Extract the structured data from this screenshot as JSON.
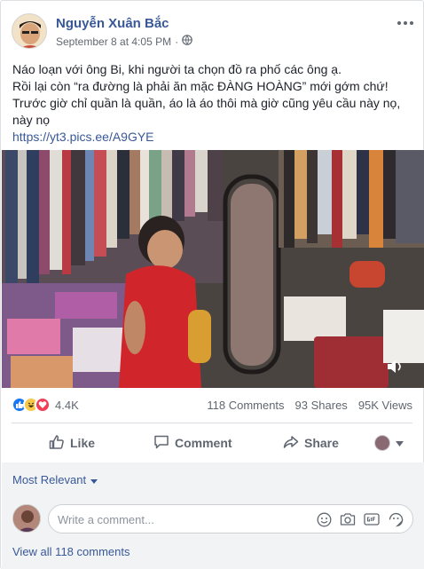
{
  "post": {
    "author": "Nguyễn Xuân Bắc",
    "timestamp": "September 8 at 4:05 PM",
    "separator": "·",
    "text_lines": [
      "Náo loạn với ông Bi, khi người ta chọn đồ ra phố các ông ạ.",
      "Rồi lại còn “ra đường là phải ăn mặc ĐÀNG HOÀNG” mới gớm chứ!",
      "Trước giờ chỉ quần là quần, áo là áo thôi mà giờ cũng yêu cầu này nọ,",
      "này nọ"
    ],
    "link": "https://yt3.pics.ee/A9GYE"
  },
  "stats": {
    "reactions_count": "4.4K",
    "comments": "118 Comments",
    "shares": "93 Shares",
    "views": "95K Views"
  },
  "actions": {
    "like": "Like",
    "comment": "Comment",
    "share": "Share"
  },
  "comments": {
    "sort_label": "Most Relevant",
    "placeholder": "Write a comment...",
    "view_all": "View all 118 comments"
  },
  "colors": {
    "link_blue": "#385898",
    "like_blue": "#1877f2",
    "haha_yellow": "#f7c94b",
    "love_red": "#f33e58"
  },
  "icons": [
    "more-options-icon",
    "globe-icon",
    "like-reaction-icon",
    "haha-reaction-icon",
    "love-reaction-icon",
    "thumbs-up-icon",
    "comment-bubble-icon",
    "share-arrow-icon",
    "caret-down-icon",
    "emoji-icon",
    "camera-icon",
    "gif-icon",
    "sticker-icon",
    "volume-icon"
  ]
}
